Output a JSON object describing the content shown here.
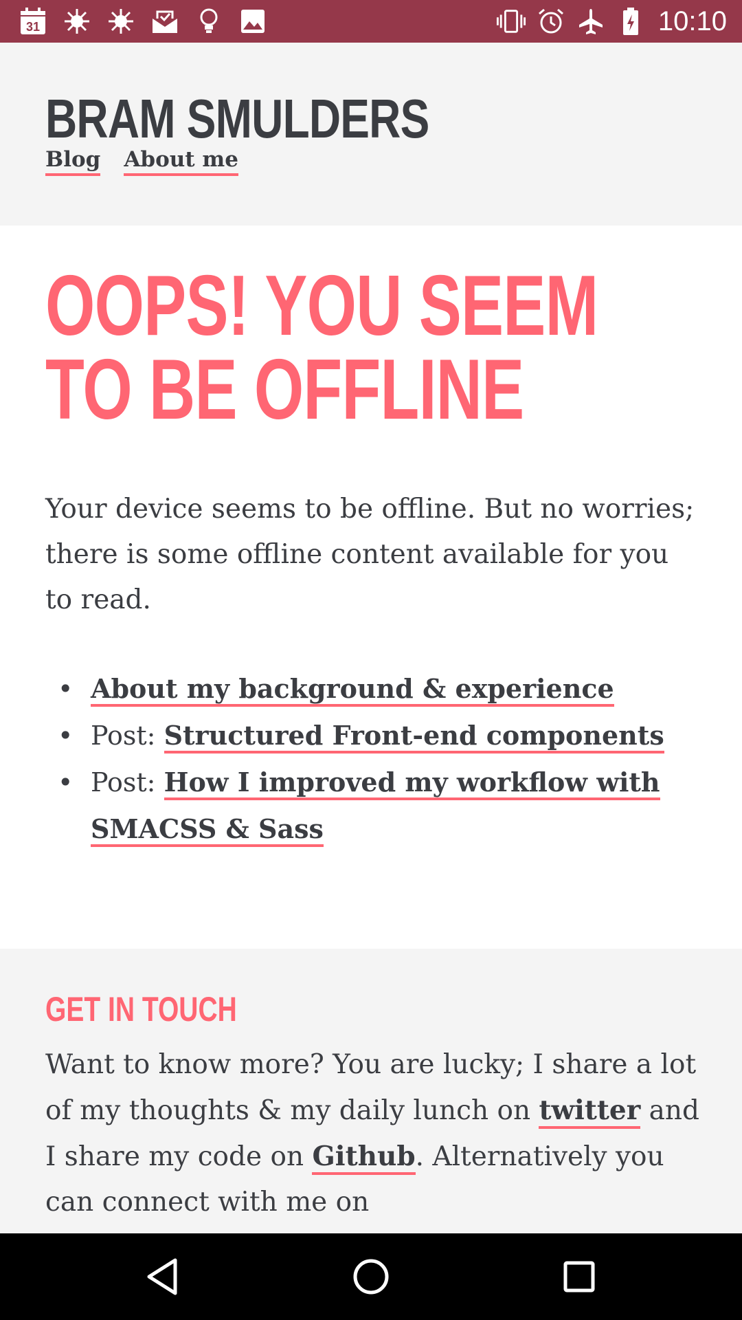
{
  "status_bar": {
    "time": "10:10",
    "calendar_day": "31",
    "left_icons": [
      "calendar-icon",
      "weather-icon",
      "weather-icon",
      "mail-icon",
      "bulb-icon",
      "image-icon"
    ],
    "right_icons": [
      "vibrate-icon",
      "alarm-icon",
      "airplane-mode-icon",
      "battery-charging-icon"
    ]
  },
  "header": {
    "site_title": "BRAM SMULDERS",
    "nav": [
      {
        "label": "Blog"
      },
      {
        "label": "About me"
      }
    ]
  },
  "main": {
    "headline": "OOPS! YOU SEEM TO BE OFFLINE",
    "intro": "Your device seems to be offline. But no worries; there is some offline content available for you to read.",
    "links": [
      {
        "prefix": "",
        "label": "About my background & experience"
      },
      {
        "prefix": "Post: ",
        "label": "Structured Front-end components"
      },
      {
        "prefix": "Post: ",
        "label": "How I improved my workflow with SMACSS & Sass"
      }
    ]
  },
  "contact": {
    "heading": "GET IN TOUCH",
    "text_1": "Want to know more? You are lucky; I share a lot of my thoughts & my daily lunch on ",
    "twitter_label": "twitter",
    "text_2": " and I share my code on ",
    "github_label": "Github",
    "text_3": ". Alternatively you can connect with me on"
  },
  "colors": {
    "status_bar": "#95384a",
    "accent": "#ff6673",
    "text": "#3b3d42",
    "header_bg": "#f4f4f4",
    "nav_bar": "#000000"
  },
  "nav_bar": {
    "buttons": [
      "back-icon",
      "home-icon",
      "recents-icon"
    ]
  }
}
